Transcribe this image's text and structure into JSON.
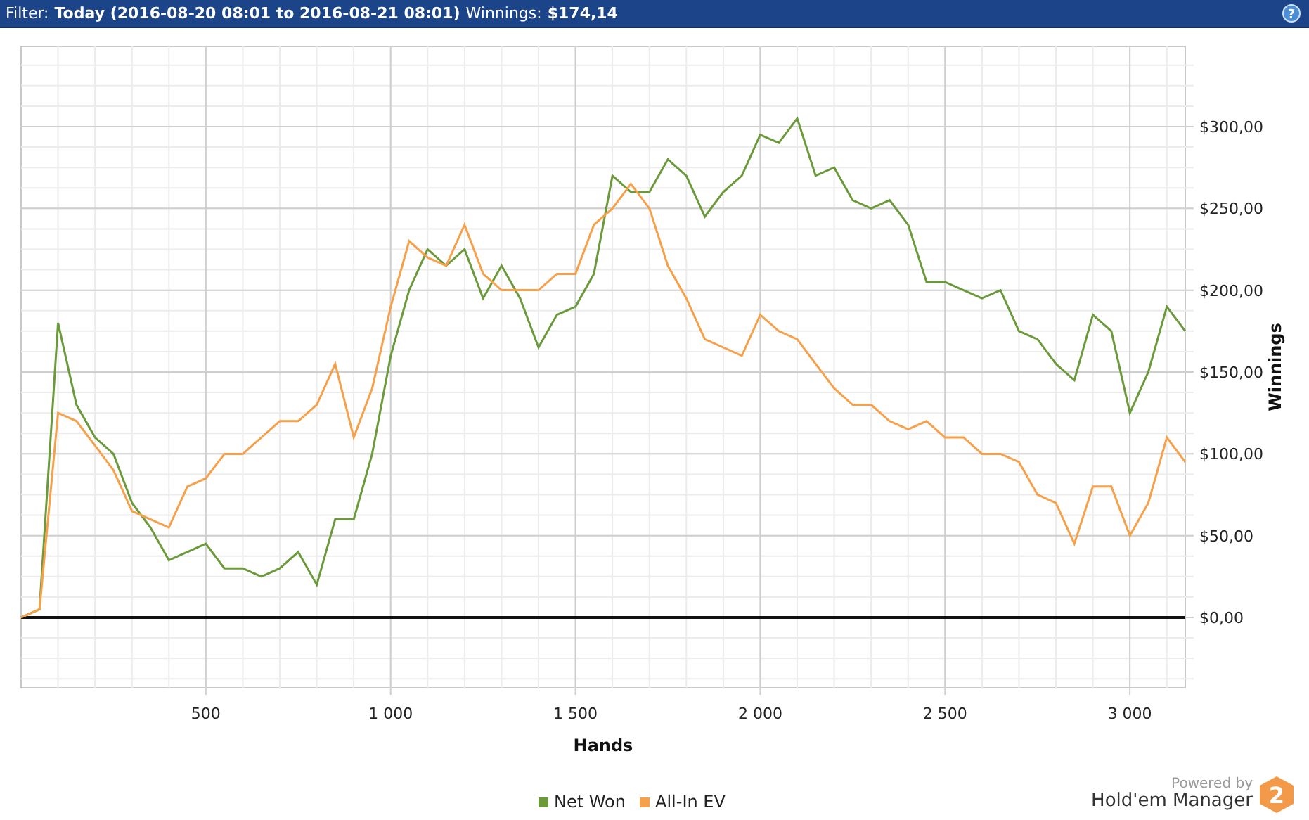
{
  "filter_bar": {
    "filter_label": "Filter:",
    "filter_value": "Today (2016-08-20 08:01 to 2016-08-21 08:01)",
    "winnings_label": "Winnings:",
    "winnings_value": "$174,14",
    "help": "?"
  },
  "chart": {
    "chart_data": {
      "type": "line",
      "xlabel": "Hands",
      "ylabel": "Winnings",
      "x": [
        0,
        50,
        100,
        150,
        200,
        250,
        300,
        350,
        400,
        450,
        500,
        550,
        600,
        650,
        700,
        750,
        800,
        850,
        900,
        950,
        1000,
        1050,
        1100,
        1150,
        1200,
        1250,
        1300,
        1350,
        1400,
        1450,
        1500,
        1550,
        1600,
        1650,
        1700,
        1750,
        1800,
        1850,
        1900,
        1950,
        2000,
        2050,
        2100,
        2150,
        2200,
        2250,
        2300,
        2350,
        2400,
        2450,
        2500,
        2550,
        2600,
        2650,
        2700,
        2750,
        2800,
        2850,
        2900,
        2950,
        3000,
        3050,
        3100,
        3150
      ],
      "series": [
        {
          "name": "Net Won",
          "color": "#6b9a3a",
          "values": [
            0,
            5,
            180,
            130,
            110,
            100,
            70,
            55,
            35,
            40,
            45,
            30,
            30,
            25,
            30,
            40,
            20,
            60,
            60,
            100,
            160,
            200,
            225,
            215,
            225,
            195,
            215,
            195,
            165,
            185,
            190,
            210,
            270,
            260,
            260,
            280,
            270,
            245,
            260,
            270,
            295,
            290,
            305,
            270,
            275,
            255,
            250,
            255,
            240,
            205,
            205,
            200,
            195,
            200,
            175,
            170,
            155,
            145,
            185,
            175,
            125,
            150,
            190,
            175
          ]
        },
        {
          "name": "All-In EV",
          "color": "#f7a04a",
          "values": [
            0,
            5,
            125,
            120,
            105,
            90,
            65,
            60,
            55,
            80,
            85,
            100,
            100,
            110,
            120,
            120,
            130,
            155,
            110,
            140,
            190,
            230,
            220,
            215,
            240,
            210,
            200,
            200,
            200,
            210,
            210,
            240,
            250,
            265,
            250,
            215,
            195,
            170,
            165,
            160,
            185,
            175,
            170,
            155,
            140,
            130,
            130,
            120,
            115,
            120,
            110,
            110,
            100,
            100,
            95,
            75,
            70,
            45,
            80,
            80,
            50,
            70,
            110,
            95
          ]
        }
      ],
      "grid": true,
      "xlim": [
        0,
        3150
      ],
      "ylim": [
        -43,
        349
      ],
      "xticks": [
        {
          "value": 500,
          "label": "500"
        },
        {
          "value": 1000,
          "label": "1 000"
        },
        {
          "value": 1500,
          "label": "1 500"
        },
        {
          "value": 2000,
          "label": "2 000"
        },
        {
          "value": 2500,
          "label": "2 500"
        },
        {
          "value": 3000,
          "label": "3 000"
        }
      ],
      "yticks": [
        {
          "value": 0,
          "label": "$0,00"
        },
        {
          "value": 50,
          "label": "$50,00"
        },
        {
          "value": 100,
          "label": "$100,00"
        },
        {
          "value": 150,
          "label": "$150,00"
        },
        {
          "value": 200,
          "label": "$200,00"
        },
        {
          "value": 250,
          "label": "$250,00"
        },
        {
          "value": 300,
          "label": "$300,00"
        }
      ]
    }
  },
  "footer": {
    "powered_by": "Powered by",
    "brand": "Hold'em Manager",
    "brand_badge": "2"
  }
}
